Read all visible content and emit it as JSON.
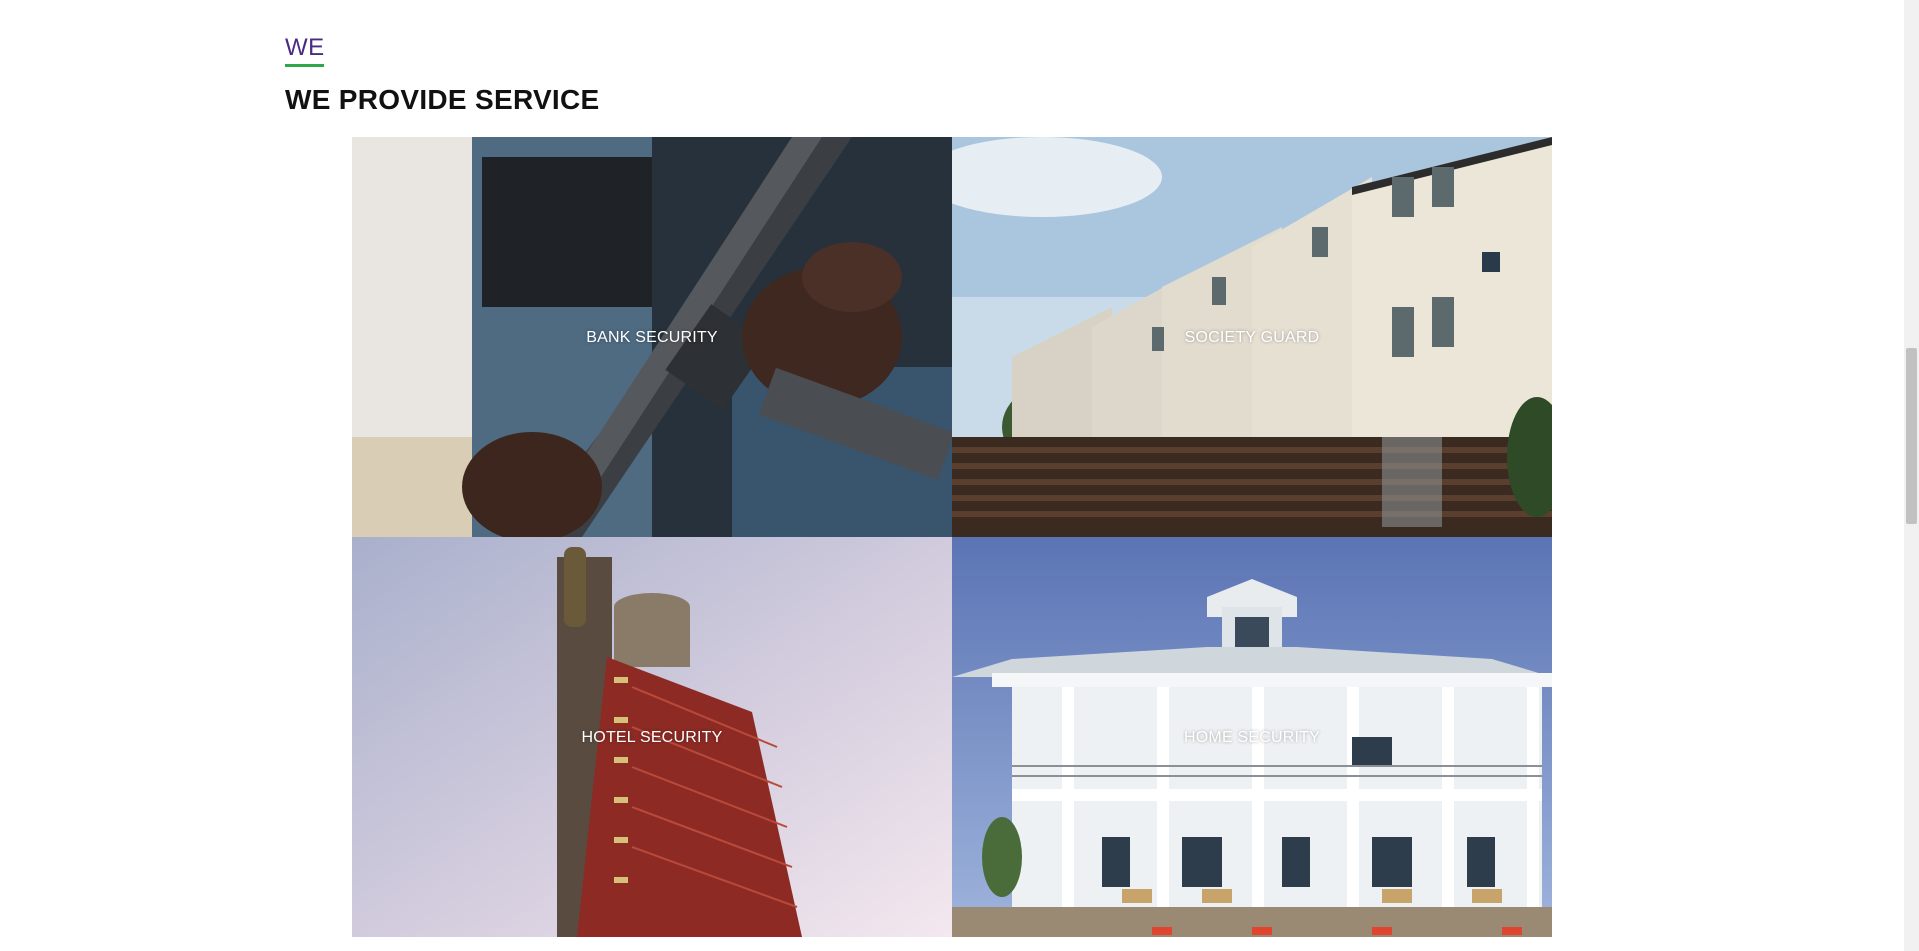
{
  "section": {
    "eyebrow": "WE",
    "title": "WE PROVIDE SERVICE"
  },
  "colors": {
    "eyebrow_text": "#4b2a82",
    "eyebrow_underline": "#2ea84a",
    "tile_label": "#ffffff"
  },
  "services": [
    {
      "label": "BANK SECURITY",
      "image": "armed-guard-photo"
    },
    {
      "label": "SOCIETY GUARD",
      "image": "townhouses-photo"
    },
    {
      "label": "HOTEL SECURITY",
      "image": "hotel-tower-photo"
    },
    {
      "label": "HOME SECURITY",
      "image": "beach-house-photo"
    }
  ]
}
